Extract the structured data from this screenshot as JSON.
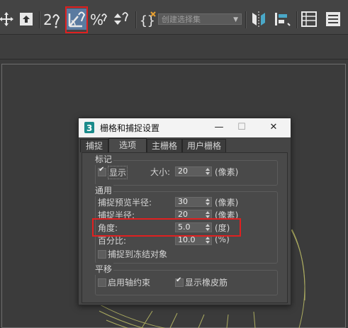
{
  "toolbar": {
    "selection_set_placeholder": "创建选择集"
  },
  "dialog": {
    "title": "栅格和捕捉设置",
    "tabs": [
      "捕捉",
      "选项",
      "主栅格",
      "用户栅格"
    ],
    "markers_group": {
      "title": "标记",
      "display_label": "显示",
      "display_checked": true,
      "size_label": "大小:",
      "size_value": "20",
      "size_unit": "(像素)"
    },
    "general_group": {
      "title": "通用",
      "preview_radius_label": "捕捉预览半径:",
      "preview_radius_value": "30",
      "preview_radius_unit": "(像素)",
      "snap_radius_label": "捕捉半径:",
      "snap_radius_value": "20",
      "snap_radius_unit": "(像素)",
      "angle_label": "角度:",
      "angle_value": "5.0",
      "angle_unit": "(度)",
      "percent_label": "百分比:",
      "percent_value": "10.0",
      "percent_unit": "(%)",
      "snap_frozen_label": "捕捉到冻结对象",
      "snap_frozen_checked": false
    },
    "translation_group": {
      "title": "平移",
      "axis_constraints_label": "启用轴约束",
      "axis_constraints_checked": false,
      "rubber_band_label": "显示橡皮筋",
      "rubber_band_checked": true
    }
  }
}
